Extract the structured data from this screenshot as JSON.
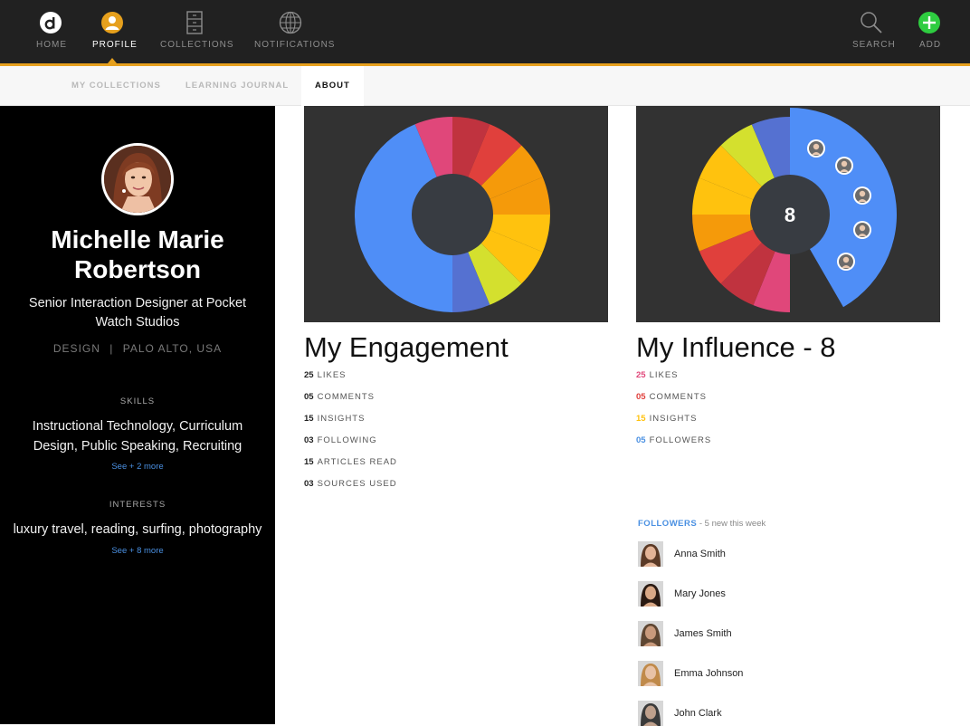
{
  "nav": {
    "items": [
      {
        "label": "HOME",
        "icon": "logo-icon"
      },
      {
        "label": "PROFILE",
        "icon": "profile-icon",
        "active": true
      },
      {
        "label": "COLLECTIONS",
        "icon": "cabinet-icon"
      },
      {
        "label": "NOTIFICATIONS",
        "icon": "globe-icon"
      }
    ],
    "search": {
      "label": "SEARCH",
      "icon": "search-icon"
    },
    "add": {
      "label": "ADD",
      "icon": "plus-icon"
    },
    "accent_color": "#e6a01d"
  },
  "subtabs": [
    {
      "label": "MY COLLECTIONS"
    },
    {
      "label": "LEARNING JOURNAL"
    },
    {
      "label": "ABOUT",
      "active": true
    }
  ],
  "profile": {
    "name_line1": "Michelle Marie",
    "name_line2": "Robertson",
    "job": "Senior Interaction Designer at Pocket Watch Studios",
    "department": "DESIGN",
    "separator": "|",
    "location": "PALO ALTO, USA",
    "skills_header": "SKILLS",
    "skills": "Instructional Technology, Curriculum Design, Public Speaking, Recruiting",
    "skills_more": "See + 2 more",
    "interests_header": "INTERESTS",
    "interests": "luxury travel, reading, surfing, photography",
    "interests_more": "See + 8 more"
  },
  "engagement": {
    "title": "My Engagement",
    "stats": [
      {
        "value": "25",
        "label": "LIKES"
      },
      {
        "value": "05",
        "label": "COMMENTS"
      },
      {
        "value": "15",
        "label": "INSIGHTS"
      },
      {
        "value": "03",
        "label": "FOLLOWING"
      },
      {
        "value": "15",
        "label": "ARTICLES READ"
      },
      {
        "value": "03",
        "label": "SOURCES USED"
      }
    ],
    "segment_colors": [
      "#e0477a",
      "#c0333f",
      "#e0403c",
      "#f59a0a",
      "#ffc20e",
      "#d4e02e",
      "#5571d1",
      "#4f8ef7"
    ]
  },
  "influence": {
    "title": "My Influence - 8",
    "center_value": "8",
    "stats": [
      {
        "value": "25",
        "label": "LIKES",
        "color": "#e0477a"
      },
      {
        "value": "05",
        "label": "COMMENTS",
        "color": "#e0403c"
      },
      {
        "value": "15",
        "label": "INSIGHTS",
        "color": "#ffc20e"
      },
      {
        "value": "05",
        "label": "FOLLOWERS",
        "color": "#4a90e2"
      }
    ]
  },
  "followers": {
    "header": "FOLLOWERS",
    "subheader": " - 5 new this week",
    "list": [
      {
        "name": "Anna Smith"
      },
      {
        "name": "Mary Jones"
      },
      {
        "name": "James Smith"
      },
      {
        "name": "Emma Johnson"
      },
      {
        "name": "John Clark"
      }
    ]
  }
}
